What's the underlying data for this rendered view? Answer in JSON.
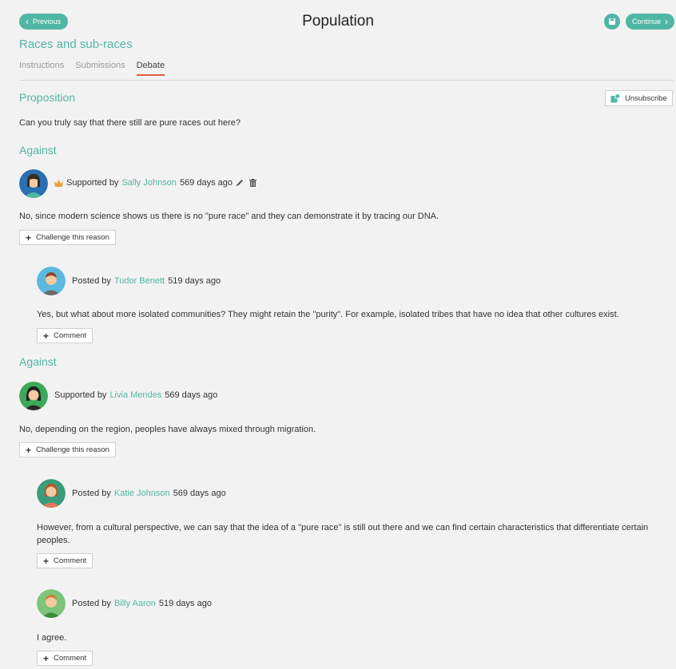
{
  "header": {
    "prev_label": "Previous",
    "title": "Population",
    "continue_label": "Continue"
  },
  "topic": {
    "title": "Races and sub-races"
  },
  "tabs": [
    {
      "label": "Instructions",
      "active": false
    },
    {
      "label": "Submissions",
      "active": false
    },
    {
      "label": "Debate",
      "active": true
    }
  ],
  "proposition": {
    "heading": "Proposition",
    "unsubscribe_label": "Unsubscribe",
    "text": "Can you truly say that there still are pure races out here?"
  },
  "arguments": [
    {
      "heading": "Against",
      "prefix": "Supported by",
      "author": "Sally Johnson",
      "time": "569 days ago",
      "has_crown": true,
      "has_edit": true,
      "text": "No, since modern science shows us there is no \"pure race\" and they can demonstrate it by tracing our DNA.",
      "challenge_label": "Challenge this reason",
      "comments": [
        {
          "prefix": "Posted by",
          "author": "Tudor Benett",
          "time": "519 days ago",
          "text": "Yes, but what about more isolated communities? They might retain the \"purity\". For example, isolated tribes that have no idea that other cultures exist.",
          "comment_label": "Comment"
        }
      ]
    },
    {
      "heading": "Against",
      "prefix": "Supported by",
      "author": "Livia Mendes",
      "time": "569 days ago",
      "text": "No, depending on the region, peoples have always mixed through migration.",
      "challenge_label": "Challenge this reason",
      "comments": [
        {
          "prefix": "Posted by",
          "author": "Katie Johnson",
          "time": "569 days ago",
          "text_line1": "However, from a cultural perspective, we can say that the idea of a \"pure race\" is still out there and we can find certain characteristics that differentiate certain",
          "text_line2": "peoples.",
          "comment_label": "Comment"
        },
        {
          "prefix": "Posted by",
          "author": "Billy Aaron",
          "time": "519 days ago",
          "text": "I agree.",
          "comment_label": "Comment"
        }
      ]
    }
  ],
  "colors": {
    "accent": "#4fb6a4",
    "active_tab_underline": "#e05a4a",
    "background": "#f2f2f2"
  }
}
